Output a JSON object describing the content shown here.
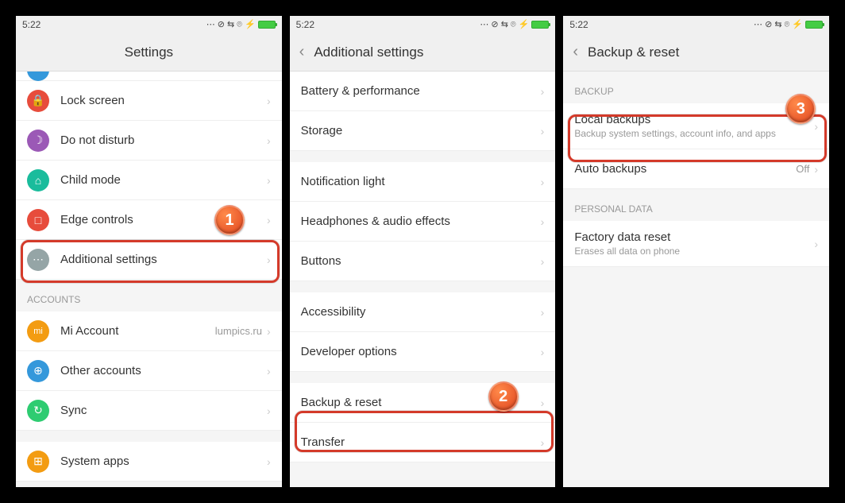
{
  "status": {
    "time": "5:22",
    "icons": "⋯ ⊘ ⇆ ⌾ ⚡"
  },
  "screen1": {
    "title": "Settings",
    "items": [
      {
        "icon_color": "#e74c3c",
        "glyph": "🔒",
        "label": "Lock screen"
      },
      {
        "icon_color": "#9b59b6",
        "glyph": "☽",
        "label": "Do not disturb"
      },
      {
        "icon_color": "#1abc9c",
        "glyph": "⌂",
        "label": "Child mode"
      },
      {
        "icon_color": "#e74c3c",
        "glyph": "□",
        "label": "Edge controls"
      },
      {
        "icon_color": "#95a5a6",
        "glyph": "⋯",
        "label": "Additional settings"
      }
    ],
    "section_accounts": "ACCOUNTS",
    "accounts": [
      {
        "icon_color": "#f39c12",
        "glyph": "mi",
        "label": "Mi Account",
        "value": "lumpics.ru"
      },
      {
        "icon_color": "#3498db",
        "glyph": "⊕",
        "label": "Other accounts"
      },
      {
        "icon_color": "#2ecc71",
        "glyph": "↻",
        "label": "Sync"
      }
    ],
    "system_apps": {
      "icon_color": "#f39c12",
      "glyph": "⊞",
      "label": "System apps"
    },
    "badge": "1"
  },
  "screen2": {
    "title": "Additional settings",
    "items": [
      {
        "label": "Battery & performance"
      },
      {
        "label": "Storage"
      },
      {
        "label": "Notification light"
      },
      {
        "label": "Headphones & audio effects"
      },
      {
        "label": "Buttons"
      },
      {
        "label": "Accessibility"
      },
      {
        "label": "Developer options"
      },
      {
        "label": "Backup & reset"
      },
      {
        "label": "Transfer"
      }
    ],
    "badge": "2"
  },
  "screen3": {
    "title": "Backup & reset",
    "section_backup": "BACKUP",
    "backup_items": [
      {
        "label": "Local backups",
        "sub": "Backup system settings, account info, and apps"
      },
      {
        "label": "Auto backups",
        "value": "Off"
      }
    ],
    "section_personal": "PERSONAL DATA",
    "personal_items": [
      {
        "label": "Factory data reset",
        "sub": "Erases all data on phone"
      }
    ],
    "badge": "3"
  }
}
